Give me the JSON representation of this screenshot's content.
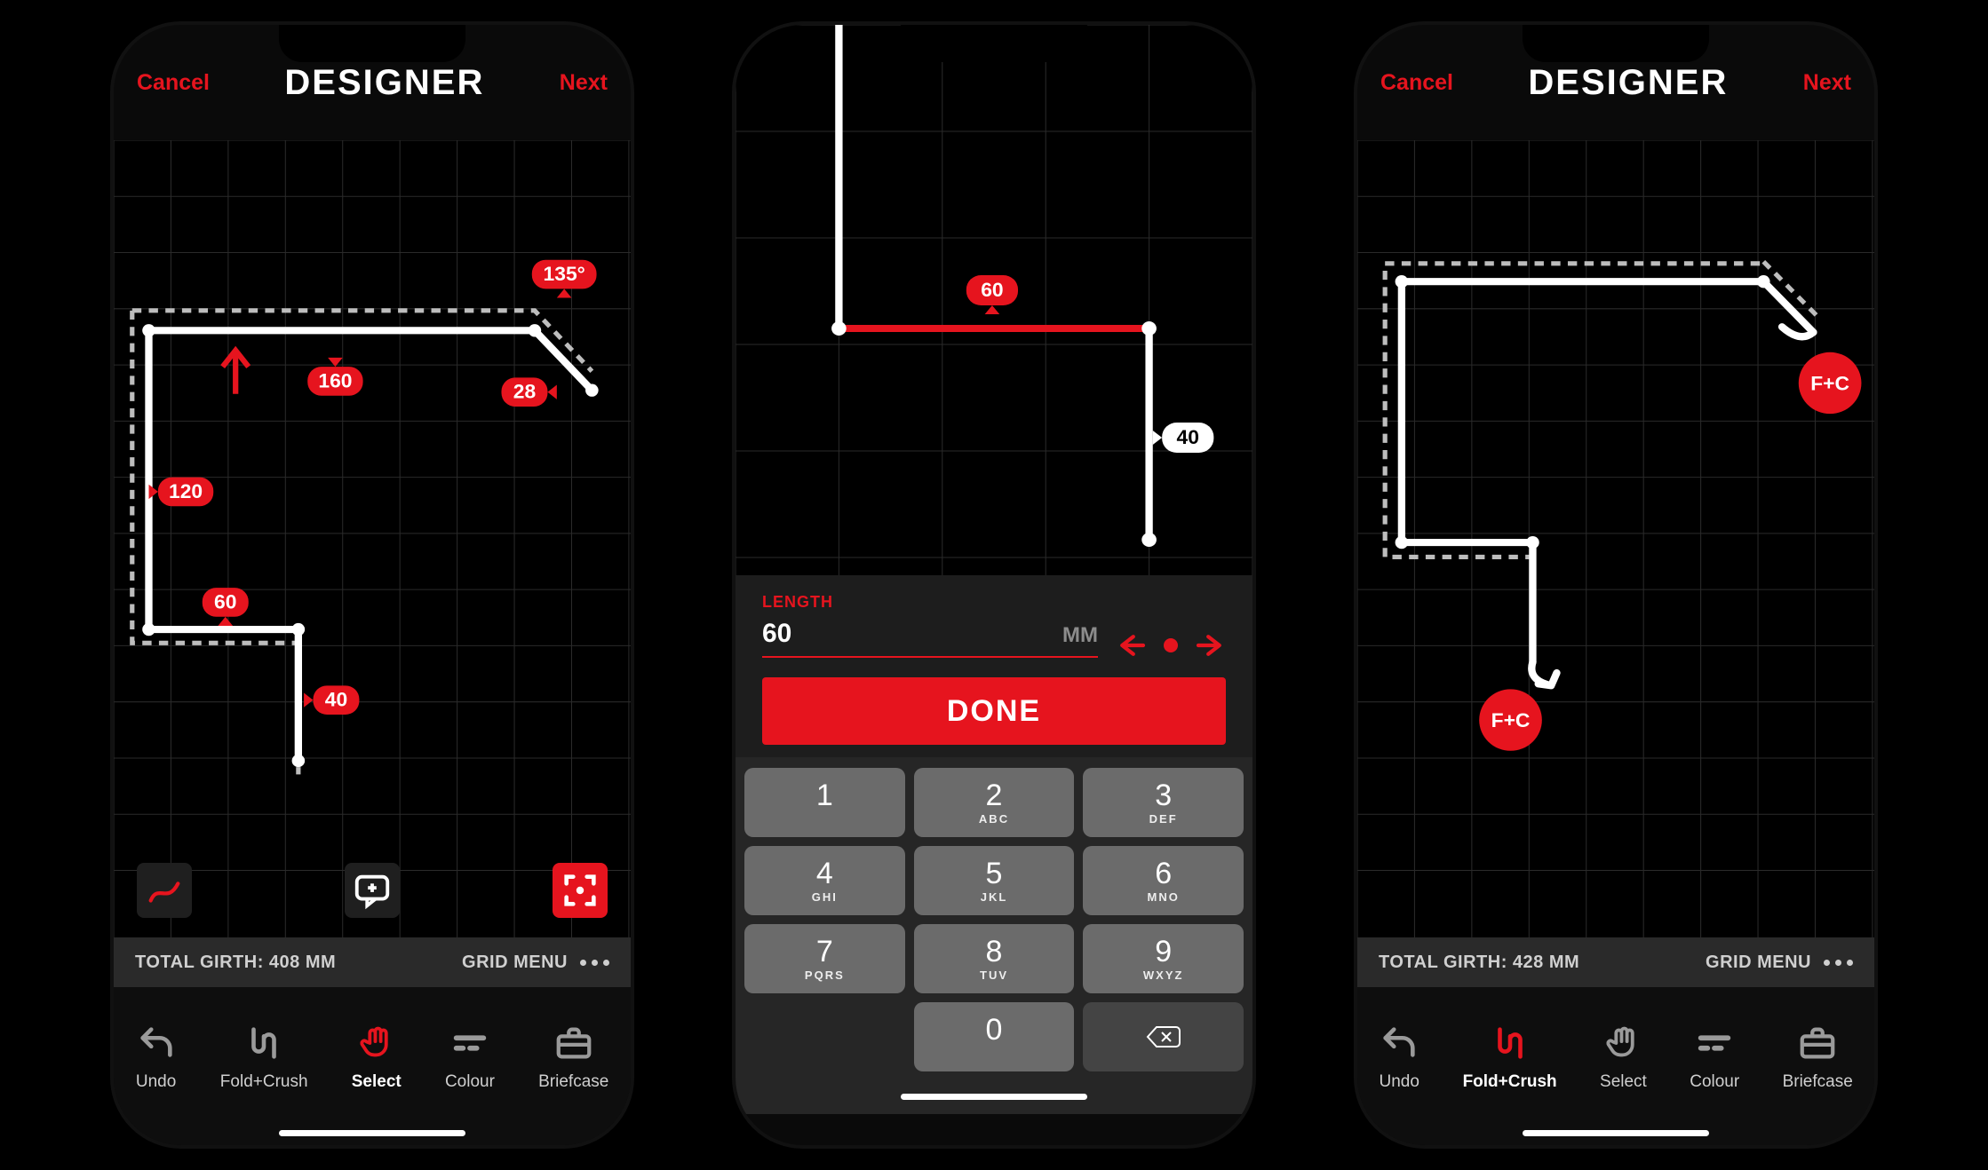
{
  "phones": {
    "p1": {
      "nav": {
        "left": "Cancel",
        "title": "DESIGNER",
        "right": "Next"
      },
      "measurements": {
        "angle": "135°",
        "seg1": "160",
        "seg2": "28",
        "seg3": "120",
        "seg4": "60",
        "seg5": "40"
      },
      "status": {
        "girth": "TOTAL GIRTH: 408 MM",
        "grid": "GRID MENU"
      },
      "toolbar": {
        "undo": "Undo",
        "fold": "Fold+Crush",
        "select": "Select",
        "colour": "Colour",
        "briefcase": "Briefcase",
        "active": "select"
      }
    },
    "p2": {
      "measurements": {
        "top": "60",
        "right": "40"
      },
      "input": {
        "label": "LENGTH",
        "value": "60",
        "unit": "MM",
        "done": "DONE"
      },
      "keypad": [
        {
          "d": "1",
          "l": ""
        },
        {
          "d": "2",
          "l": "ABC"
        },
        {
          "d": "3",
          "l": "DEF"
        },
        {
          "d": "4",
          "l": "GHI"
        },
        {
          "d": "5",
          "l": "JKL"
        },
        {
          "d": "6",
          "l": "MNO"
        },
        {
          "d": "7",
          "l": "PQRS"
        },
        {
          "d": "8",
          "l": "TUV"
        },
        {
          "d": "9",
          "l": "WXYZ"
        },
        {
          "d": "0",
          "l": ""
        }
      ]
    },
    "p3": {
      "nav": {
        "left": "Cancel",
        "title": "DESIGNER",
        "right": "Next"
      },
      "fc": {
        "tag": "F+C"
      },
      "status": {
        "girth": "TOTAL GIRTH: 428 MM",
        "grid": "GRID MENU"
      },
      "toolbar": {
        "undo": "Undo",
        "fold": "Fold+Crush",
        "select": "Select",
        "colour": "Colour",
        "briefcase": "Briefcase",
        "active": "fold"
      }
    }
  },
  "chart_data": [
    {
      "type": "line",
      "phone": 1,
      "title": "Flashing profile – Select mode",
      "segments_mm": [
        {
          "label": "120",
          "dir": "up"
        },
        {
          "label": "160",
          "dir": "right"
        },
        {
          "label": "28",
          "dir": "down-right",
          "angle_deg": 135
        },
        {
          "label": "60",
          "dir": "left"
        },
        {
          "label": "40",
          "dir": "down"
        }
      ],
      "total_girth_mm": 408
    },
    {
      "type": "line",
      "phone": 2,
      "title": "Length entry – editing top segment",
      "selected_segment_mm": 60,
      "right_segment_mm": 40,
      "input": {
        "field": "LENGTH",
        "value": 60,
        "unit": "MM"
      }
    },
    {
      "type": "line",
      "phone": 3,
      "title": "Flashing profile – Fold+Crush mode",
      "fold_crush_ends": 2,
      "total_girth_mm": 428
    }
  ]
}
